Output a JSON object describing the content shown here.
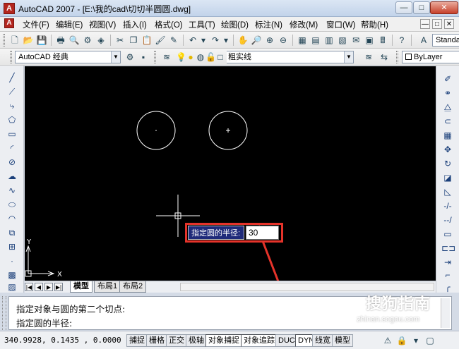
{
  "window": {
    "title": "AutoCAD 2007 - [E:\\我的cad\\切切半圆圆.dwg]",
    "app_icon": "A",
    "controls": [
      "—",
      "□",
      "✕"
    ]
  },
  "menu": {
    "items": [
      "文件(F)",
      "编辑(E)",
      "视图(V)",
      "插入(I)",
      "格式(O)",
      "工具(T)",
      "绘图(D)",
      "标注(N)",
      "修改(M)",
      "窗口(W)",
      "帮助(H)"
    ],
    "mdi_controls": [
      "—",
      "□",
      "✕"
    ]
  },
  "toolbar": {
    "style_combo": "Standa",
    "workspace_combo": "AutoCAD 经典",
    "layer_combo": "粗实线",
    "color_combo": "ByLayer"
  },
  "canvas": {
    "background": "#000000",
    "ucs_y": "Y",
    "ucs_x": "X"
  },
  "dynamic_input": {
    "prompt": "指定圆的半径:",
    "value": "30",
    "highlight_color": "#e5332a"
  },
  "layout_tabs": {
    "nav": [
      "|◀",
      "◀",
      "▶",
      "▶|"
    ],
    "tabs": [
      "模型",
      "布局1",
      "布局2"
    ],
    "active": "模型"
  },
  "command_line": {
    "lines": [
      "指定对象与圆的第二个切点:",
      "指定圆的半径:"
    ]
  },
  "status_bar": {
    "coordinates": "340.9928, 0.1435  , 0.0000",
    "buttons": [
      "捕捉",
      "栅格",
      "正交",
      "极轴",
      "对象捕捉",
      "对象追踪",
      "DUCS",
      "DYN",
      "线宽",
      "模型"
    ],
    "on_buttons": [
      "对象捕捉",
      "对象追踪",
      "DYN"
    ]
  },
  "watermark": {
    "brand": "搜狗指南",
    "url": "zhinan.sogou.com"
  }
}
